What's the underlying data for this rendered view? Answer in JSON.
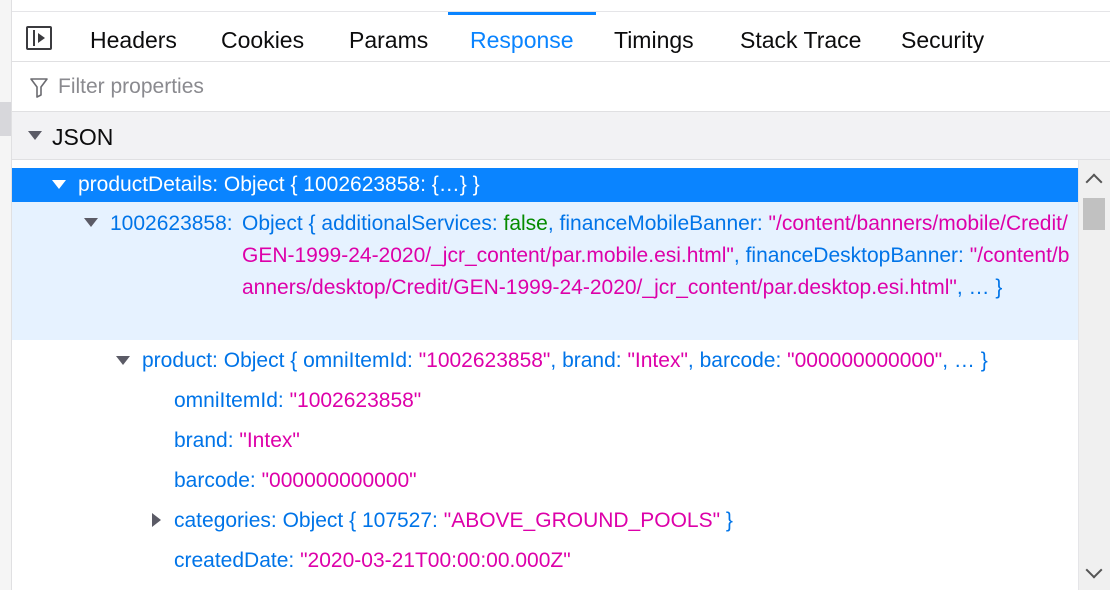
{
  "tabs": [
    {
      "label": "Headers"
    },
    {
      "label": "Cookies"
    },
    {
      "label": "Params"
    },
    {
      "label": "Response",
      "selected": true
    },
    {
      "label": "Timings"
    },
    {
      "label": "Stack Trace"
    },
    {
      "label": "Security"
    }
  ],
  "filter": {
    "placeholder": "Filter properties",
    "value": ""
  },
  "section": {
    "label": "JSON"
  },
  "tree": {
    "productDetails": {
      "key": "productDetails:",
      "summary": "Object { 1002623858: {…} }"
    },
    "item": {
      "key": "1002623858:",
      "obj_open": "Object {",
      "k1": "additionalServices:",
      "v1": "false",
      "sep1": ",",
      "k2": "financeMobileBanner:",
      "v2": "\"/content/banners/mobile/Credit/GEN-1999-24-2020/_jcr_content/par.mobile.esi.html\"",
      "sep2": ",",
      "k3": "financeDesktopBanner:",
      "v3": "\"/content/banners/desktop/Credit/GEN-1999-24-2020/_jcr_content/par.desktop.esi.html\"",
      "tail": ", … }"
    },
    "product": {
      "key": "product:",
      "obj_open": "Object {",
      "k1": "omniItemId:",
      "v1": "\"1002623858\"",
      "k2": "brand:",
      "v2": "\"Intex\"",
      "k3": "barcode:",
      "v3": "\"000000000000\"",
      "tail": ", … }"
    },
    "props": [
      {
        "key": "omniItemId:",
        "value": "\"1002623858\""
      },
      {
        "key": "brand:",
        "value": "\"Intex\""
      },
      {
        "key": "barcode:",
        "value": "\"000000000000\""
      }
    ],
    "categories": {
      "key": "categories:",
      "obj_open": "Object {",
      "k1": "107527:",
      "v1": "\"ABOVE_GROUND_POOLS\"",
      "tail": "}"
    },
    "createdDate": {
      "key": "createdDate:",
      "value": "\"2020-03-21T00:00:00.000Z\""
    }
  },
  "colors": {
    "accent": "#0a84ff",
    "key": "#0074e8",
    "string": "#dd00a9",
    "boolean": "#058b00"
  }
}
